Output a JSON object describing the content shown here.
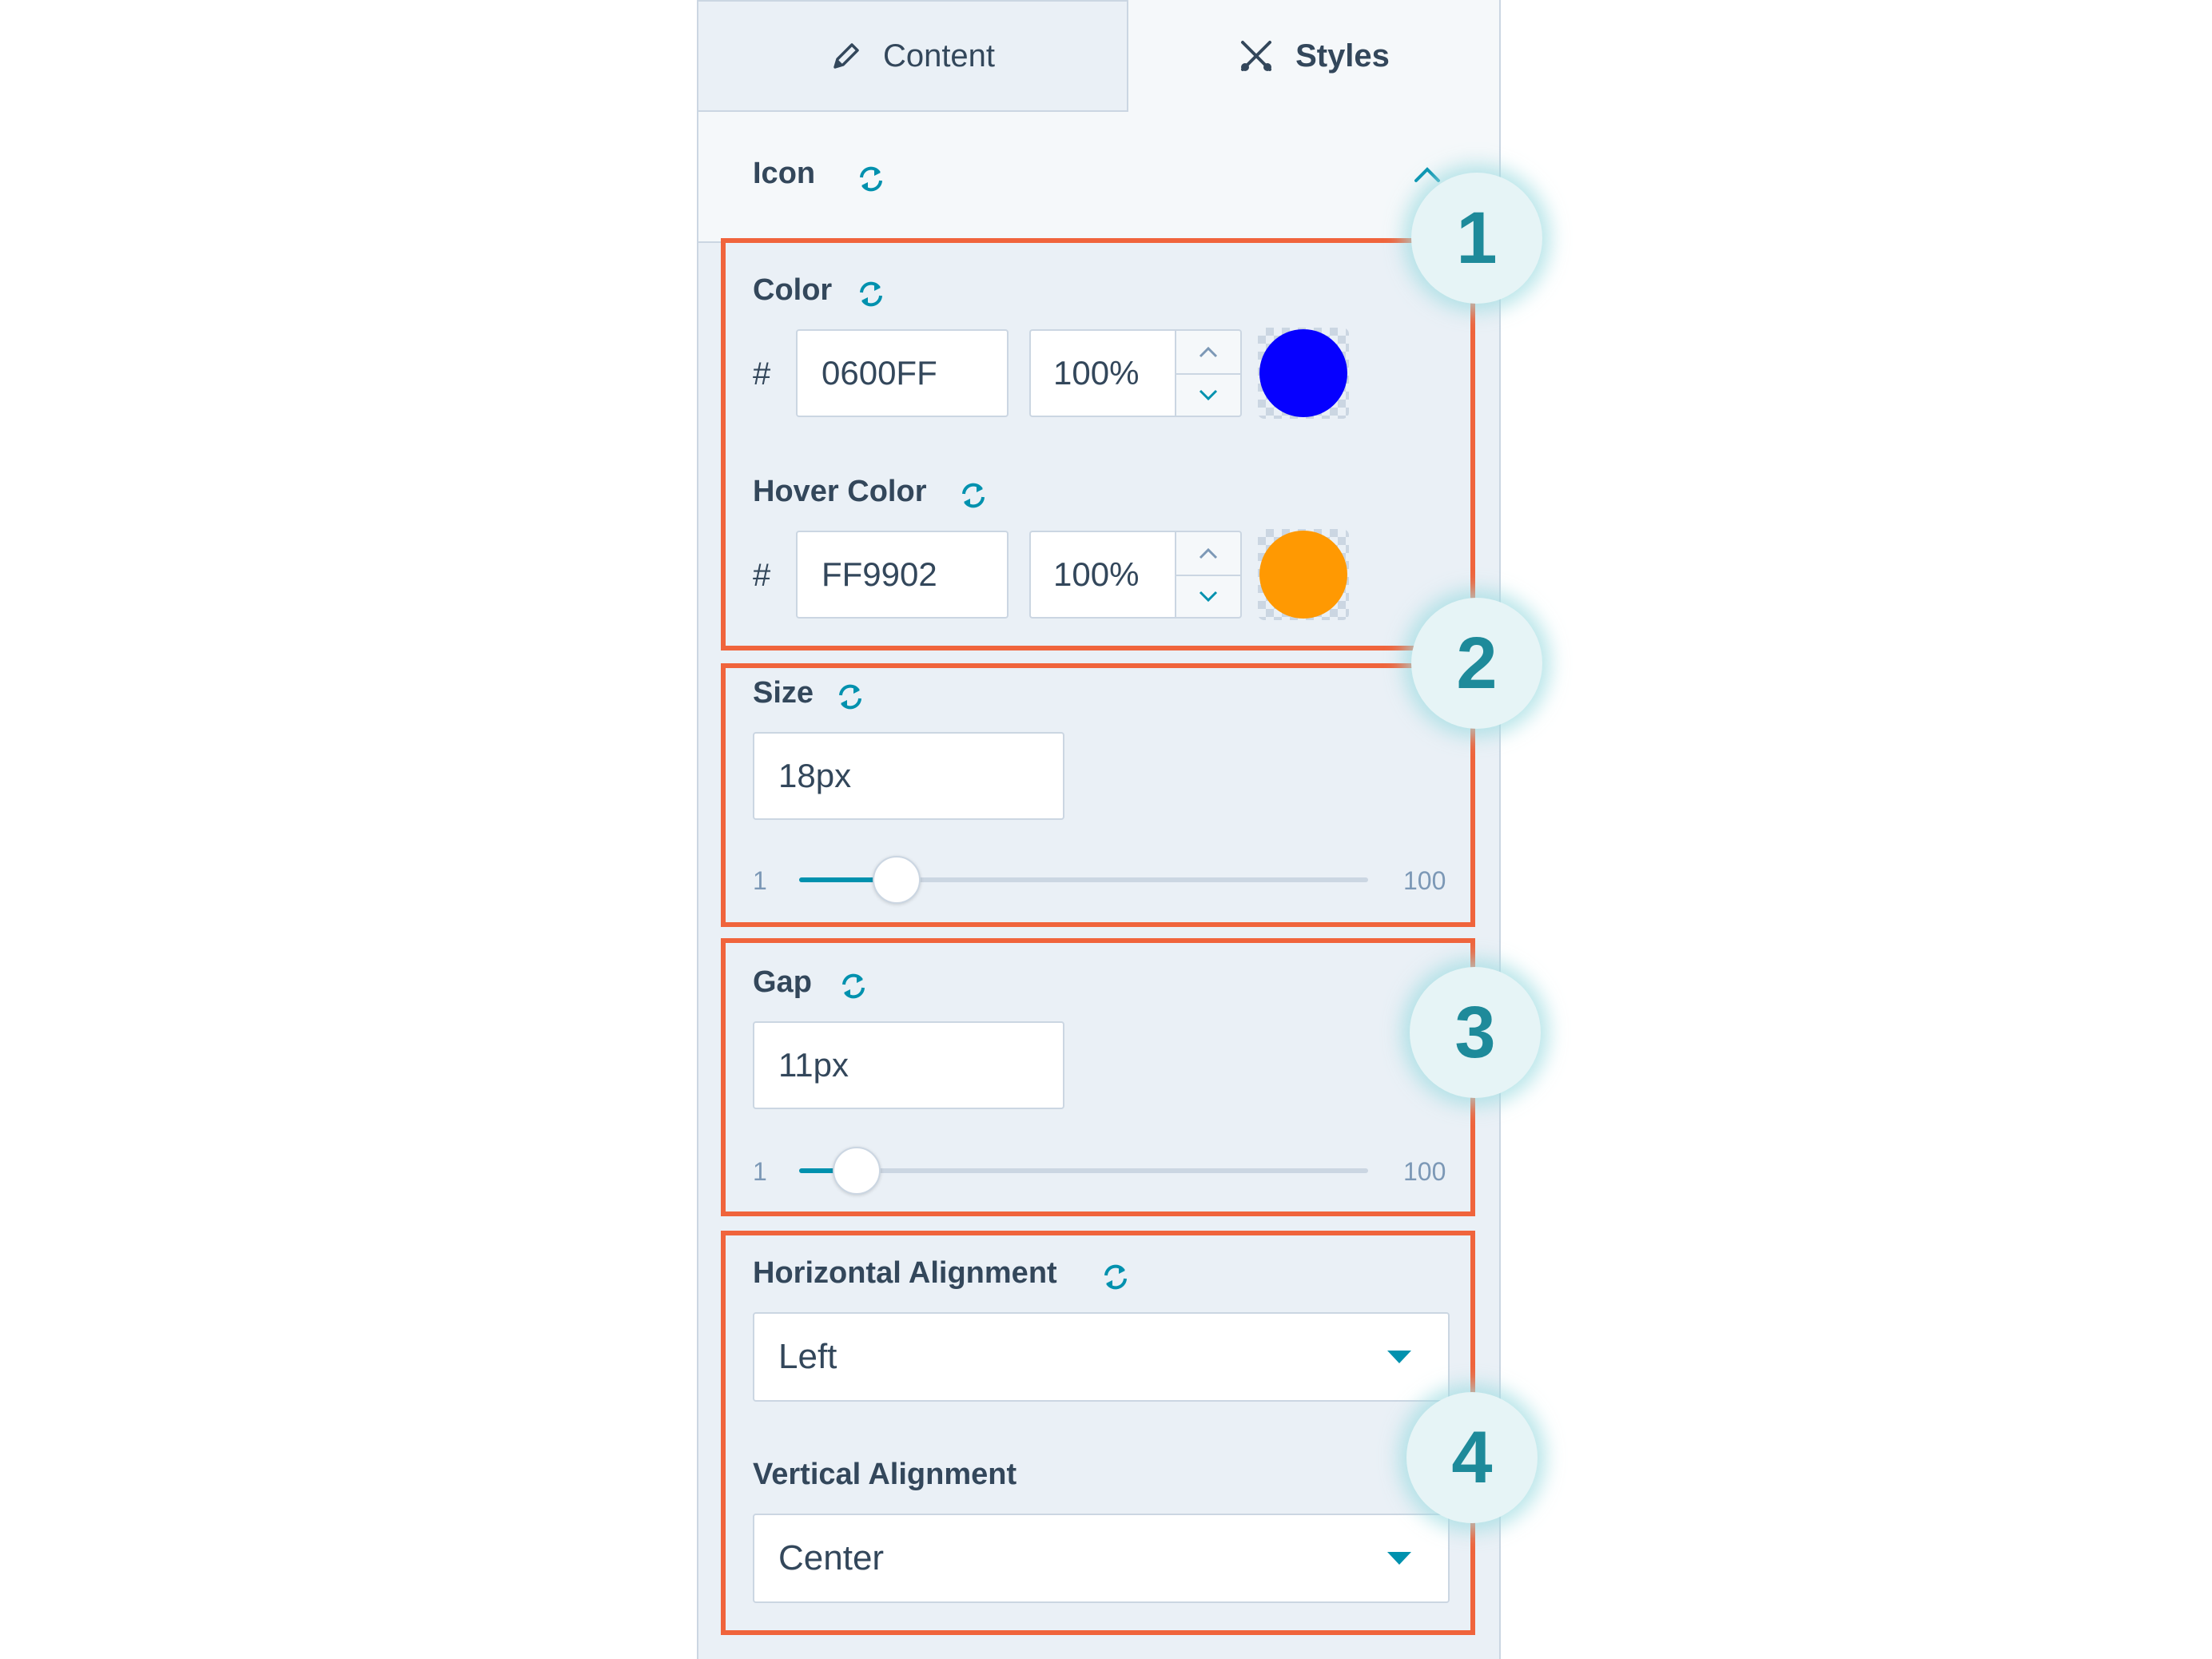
{
  "tabs": {
    "content_label": "Content",
    "styles_label": "Styles"
  },
  "section": {
    "title": "Icon"
  },
  "color": {
    "label": "Color",
    "hash": "#",
    "hex": "0600FF",
    "opacity": "100%",
    "swatch": "#0600FF"
  },
  "hover_color": {
    "label": "Hover Color",
    "hash": "#",
    "hex": "FF9902",
    "opacity": "100%",
    "swatch": "#FF9902"
  },
  "size": {
    "label": "Size",
    "value": "18px",
    "min": "1",
    "max": "100",
    "level": 18
  },
  "gap": {
    "label": "Gap",
    "value": "11px",
    "min": "1",
    "max": "100",
    "level": 11
  },
  "horizontal_alignment": {
    "label": "Horizontal Alignment",
    "value": "Left"
  },
  "vertical_alignment": {
    "label": "Vertical Alignment",
    "value": "Center"
  },
  "callouts": [
    "1",
    "2",
    "3",
    "4"
  ],
  "colors": {
    "accent": "#0091ae",
    "callout_border": "#f0643c",
    "badge_text": "#1e8a9a"
  }
}
